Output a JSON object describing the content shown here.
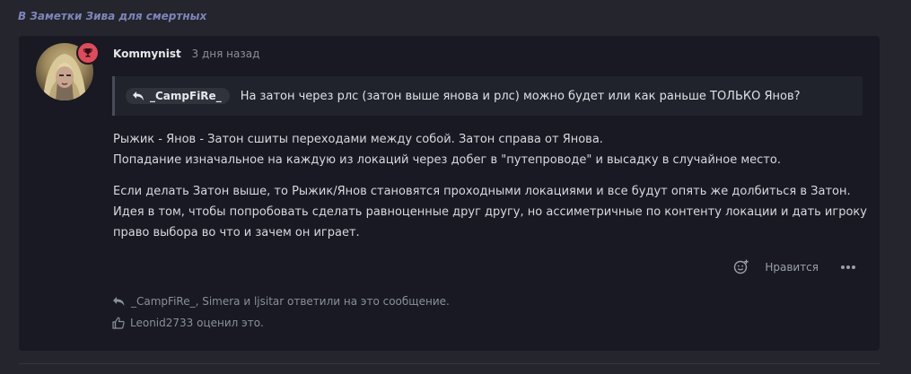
{
  "breadcrumb": {
    "label": "В Заметки Зива для смертных"
  },
  "post": {
    "author": "Kommynist",
    "time": "3 дня назад",
    "quote": {
      "author": "_CampFiRe_",
      "text": "На затон через рлс (затон выше янова и рлс) можно будет или как раньше ТОЛЬКО Янов?"
    },
    "paragraphs": [
      "Рыжик - Янов - Затон сшиты переходами между собой. Затон справа от Янова.",
      "Попадание изначальное на каждую из локаций через добег в \"путепроводе\" и высадку в случайное место.",
      "Если делать Затон выше, то Рыжик/Янов становятся проходными локациями и все будут опять же долбиться в Затон. Идея в том, чтобы попробовать сделать равноценные друг другу, но ассиметричные по контенту локации и дать игроку право выбора во что и зачем он играет."
    ],
    "actions": {
      "like_label": "Нравится",
      "icons": [
        "smiley-react-icon",
        "more-dots-icon"
      ]
    },
    "replies_text": "_CampFiRe_, Simera и ljsitar ответили на это сообщение.",
    "likes_text": "Leonid2733 оценил это."
  },
  "colors": {
    "page_bg": "#24252d",
    "card_bg": "#181922",
    "breadcrumb": "#7e85b8",
    "badge": "#e14a5a"
  }
}
